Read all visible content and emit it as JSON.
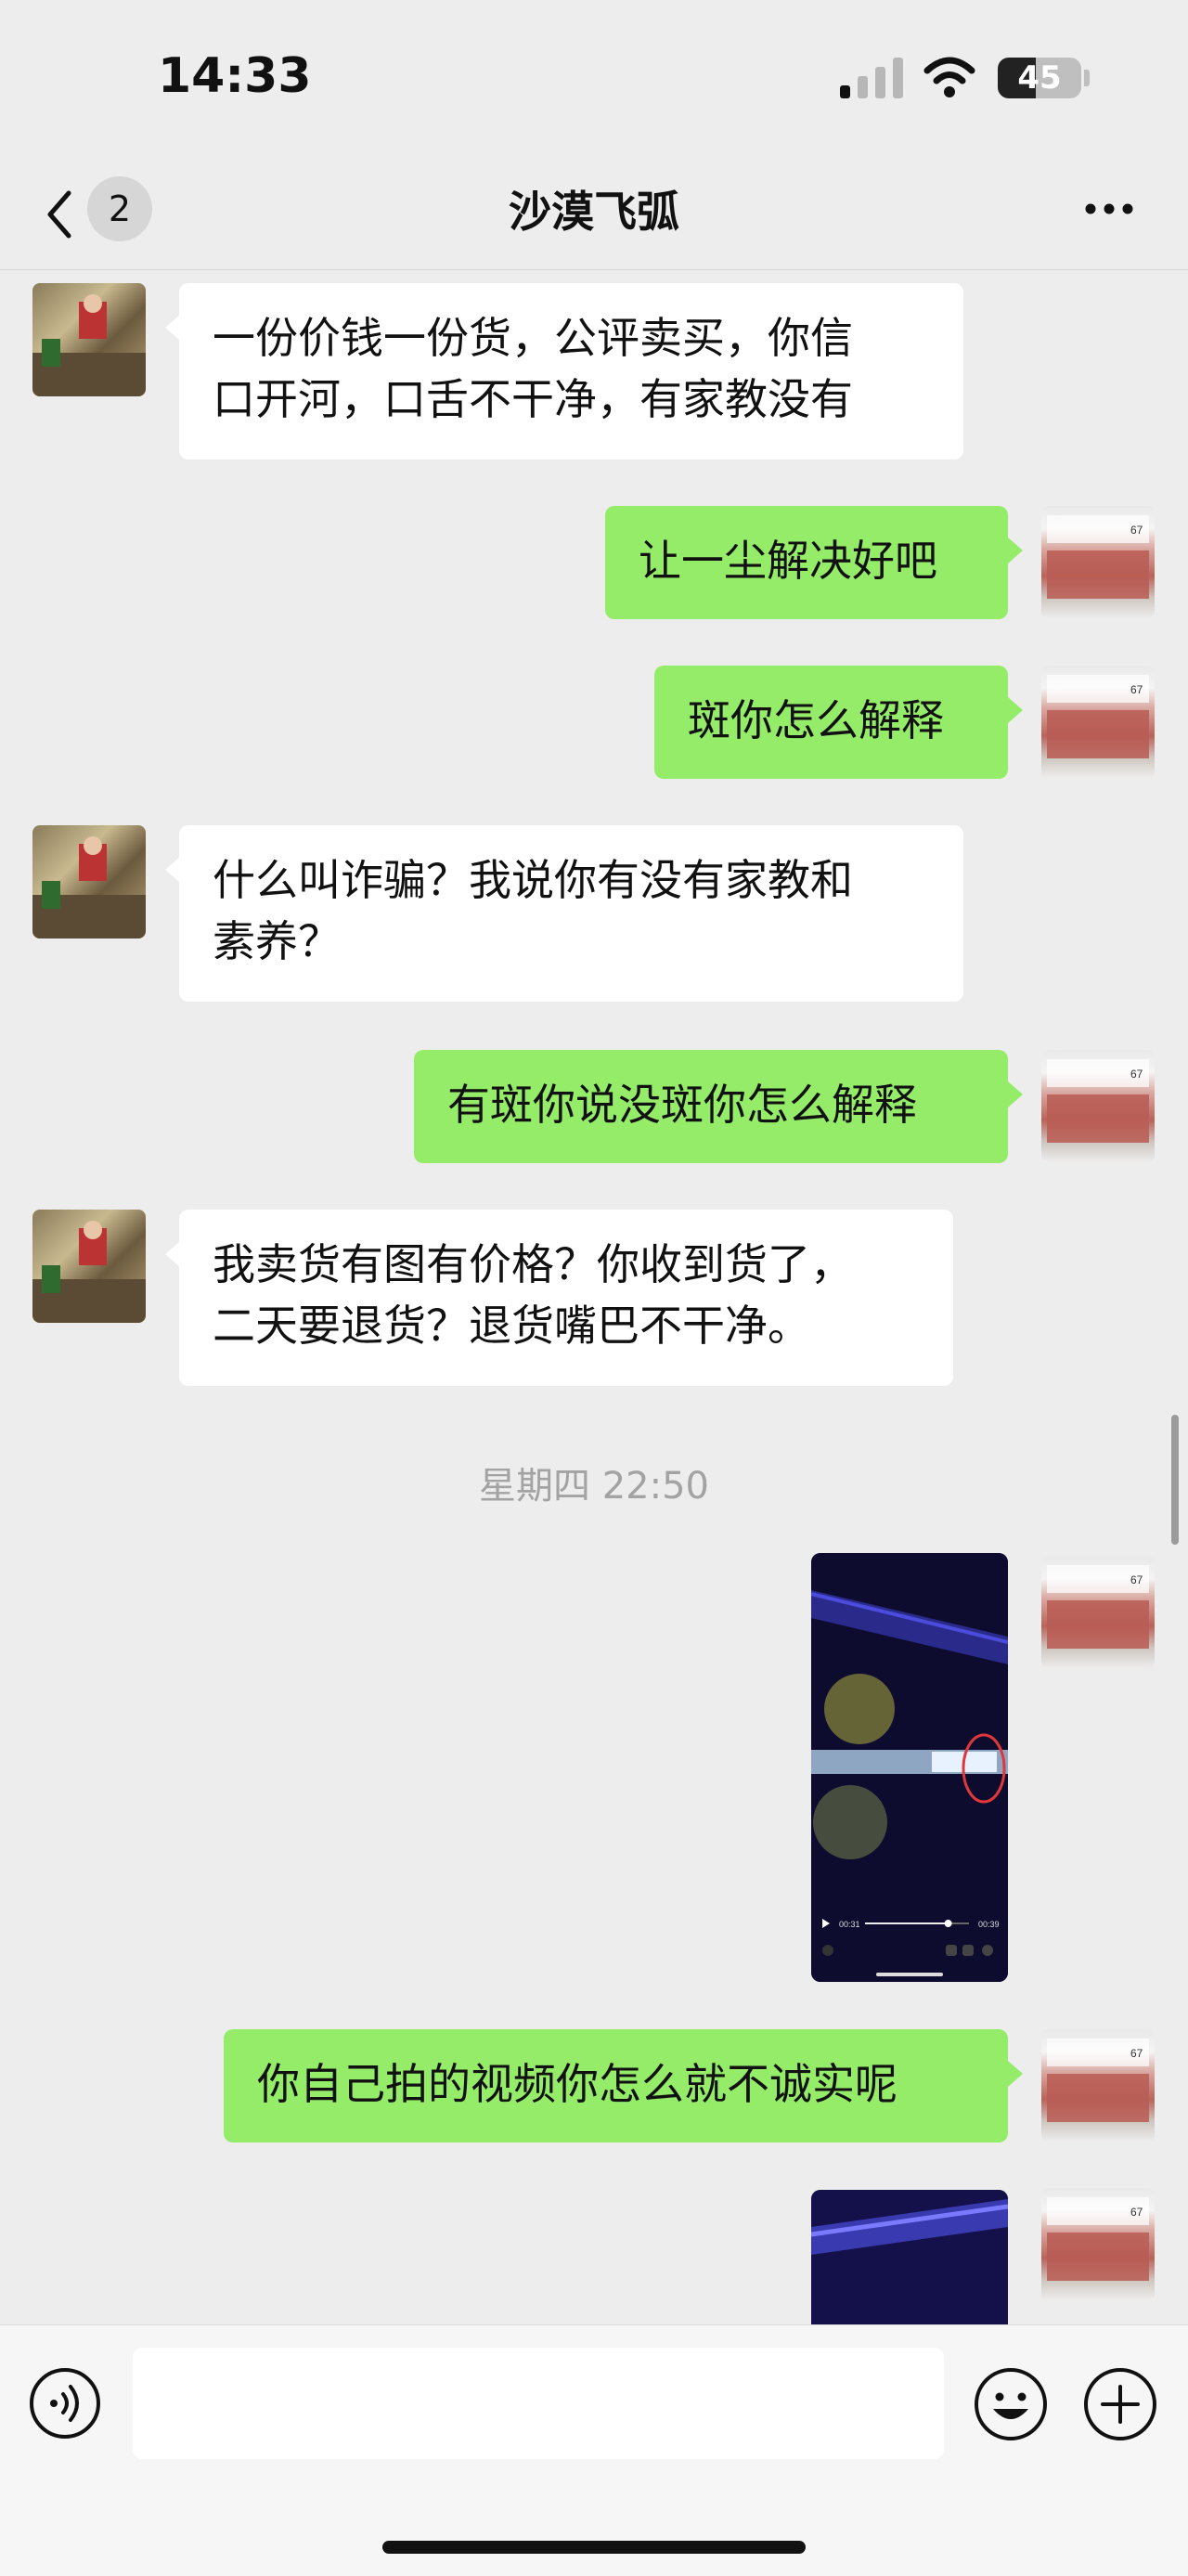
{
  "status_bar": {
    "time": "14:33",
    "battery_percent": "45",
    "battery_level": 0.45,
    "signal_bars_active": 1
  },
  "nav": {
    "unread_count": "2",
    "title": "沙漠飞弧"
  },
  "messages": [
    {
      "side": "in",
      "text": "一份价钱一份货，公评卖买，你信\n口开河，口舌不干净，有家教没有"
    },
    {
      "side": "out",
      "text": "让一尘解决好吧"
    },
    {
      "side": "out",
      "text": "斑你怎么解释"
    },
    {
      "side": "in",
      "text": "什么叫诈骗？我说你有没有家教和\n素养？"
    },
    {
      "side": "out",
      "text": "有斑你说没斑你怎么解释"
    },
    {
      "side": "in",
      "text": "我卖货有图有价格？你收到货了，\n二天要退货？退货嘴巴不干净。"
    },
    {
      "side": "out",
      "text": "你自己拍的视频你怎么就不诚实呢"
    }
  ],
  "timestamp": "星期四 22:50",
  "video": {
    "elapsed": "00:31",
    "duration": "00:39",
    "progress": 0.8
  },
  "colors": {
    "bg": "#ededed",
    "bubble_out": "#95ec69",
    "bubble_in": "#ffffff"
  }
}
